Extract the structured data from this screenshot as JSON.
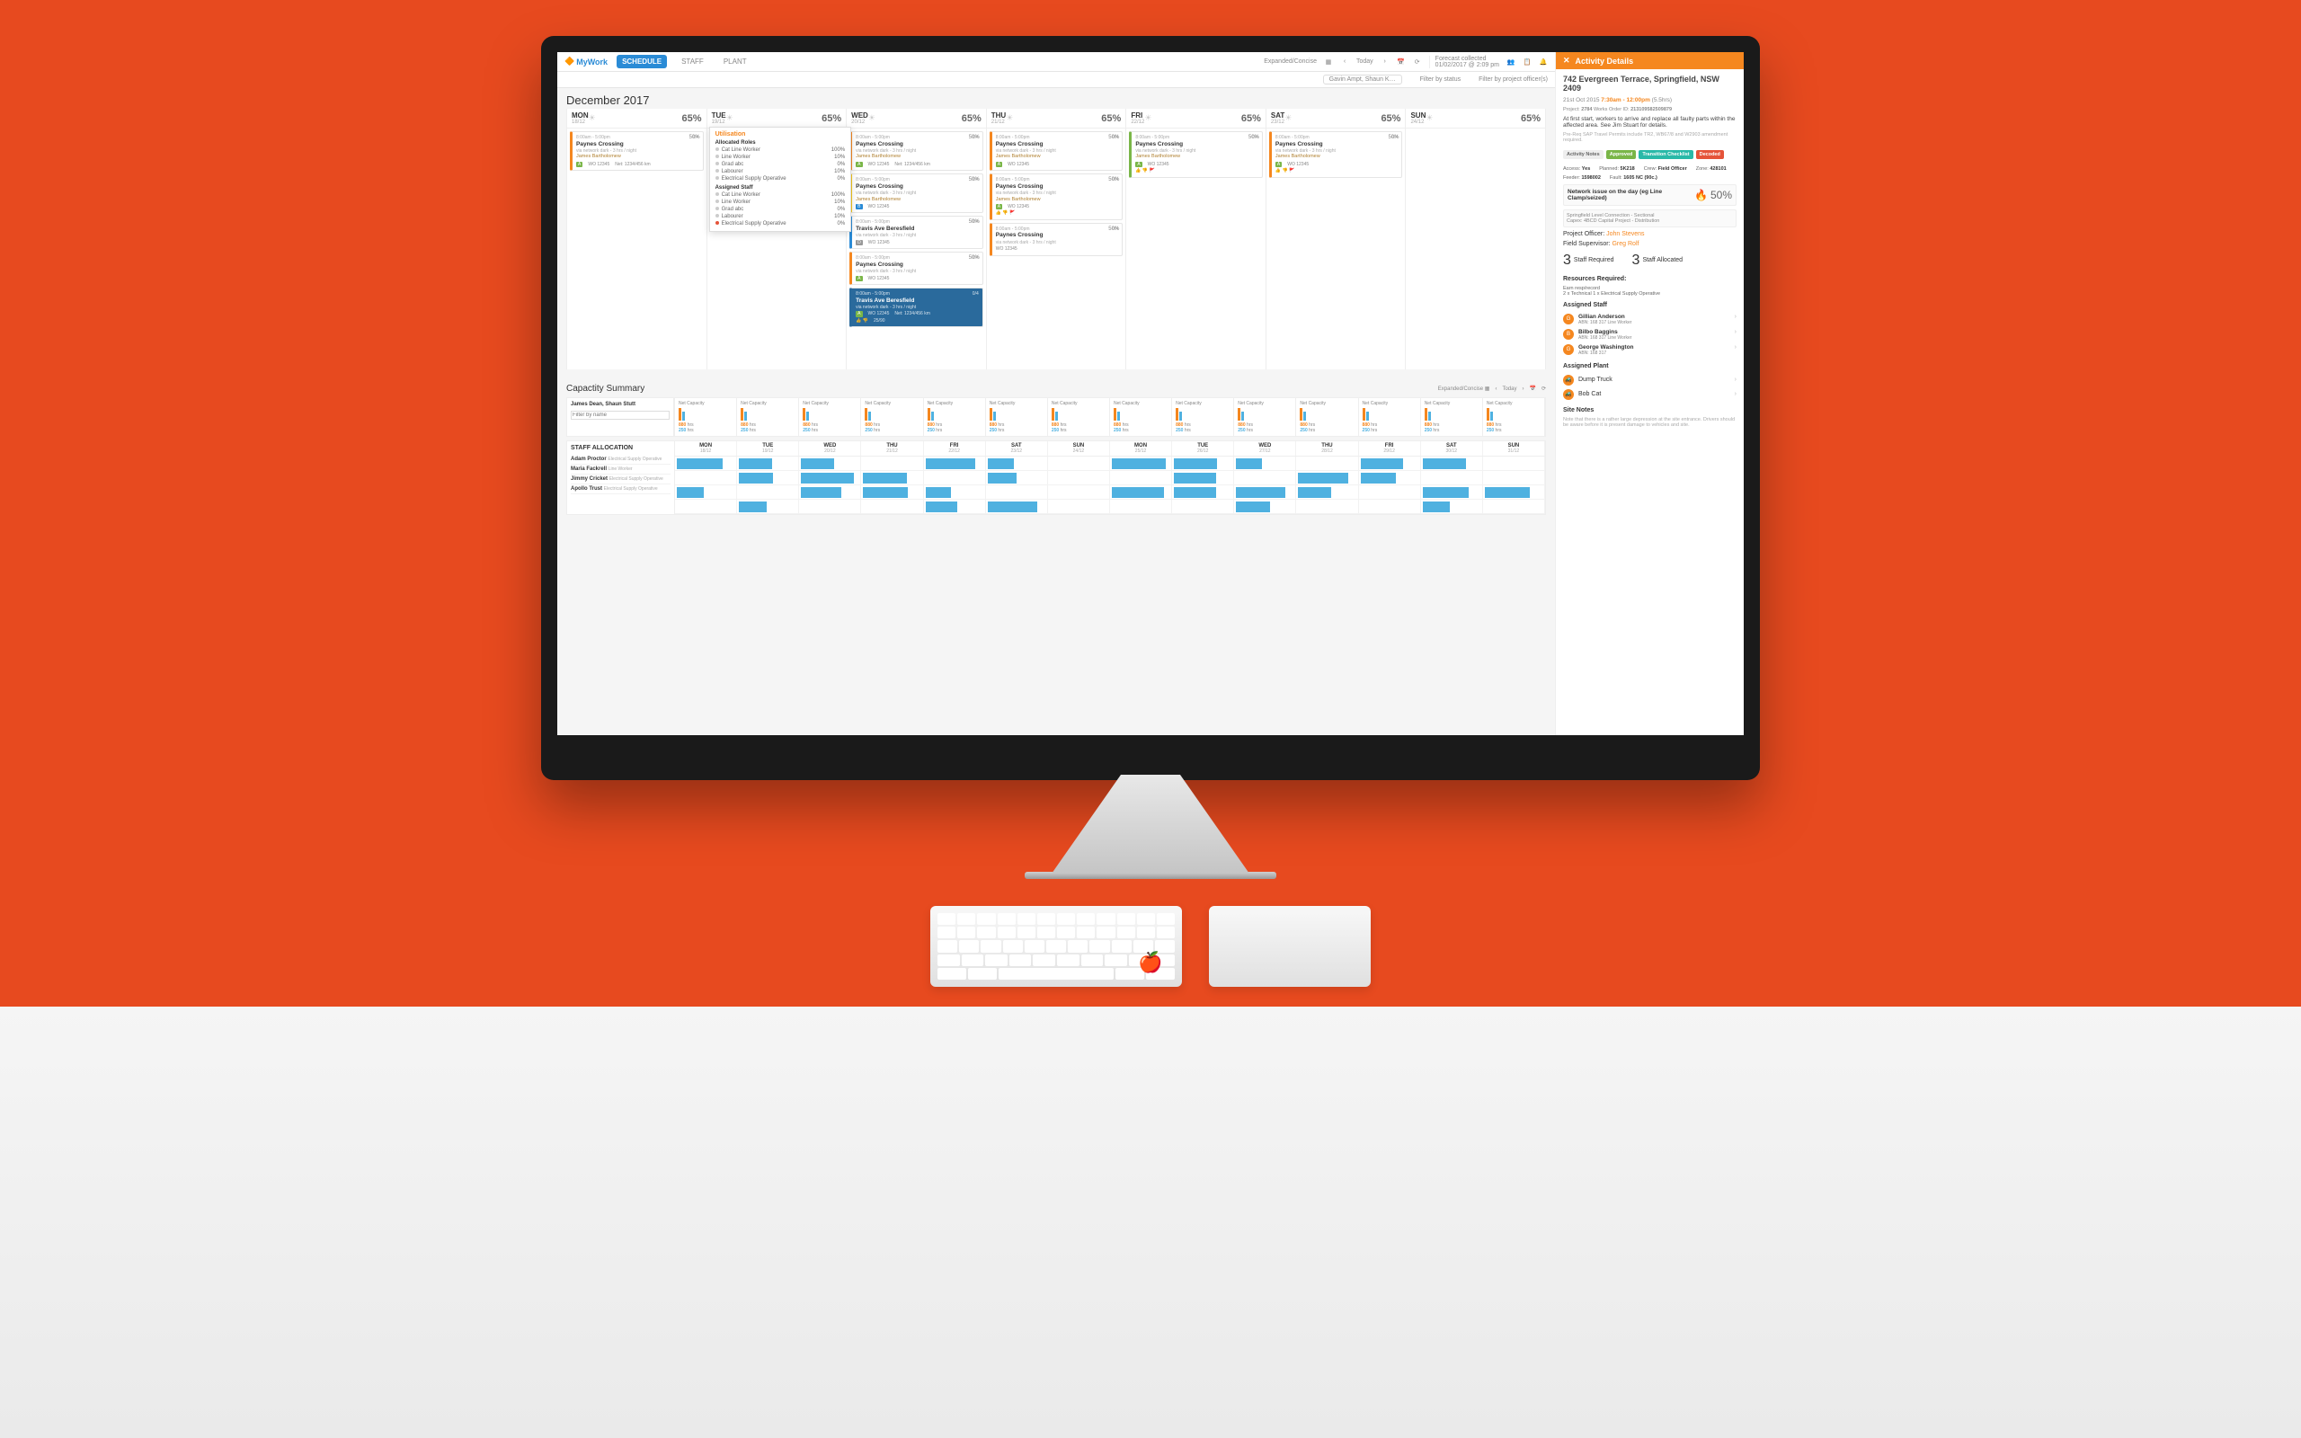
{
  "app": {
    "name": "MyWork"
  },
  "nav": {
    "tabs": [
      "SCHEDULE",
      "STAFF",
      "PLANT"
    ]
  },
  "top_right": {
    "view_toggle": "Expanded/Concise",
    "today": "Today",
    "forecast_label": "Forecast collected",
    "forecast_time": "01/02/2017 @ 2:09 pm"
  },
  "filters": {
    "people": "Gavin Ampt, Shaun K…",
    "status_ph": "Filter by status",
    "officer_ph": "Filter by project officer(s)"
  },
  "title": "December 2017",
  "days": [
    {
      "name": "MON",
      "date": "18/12",
      "util": "65%"
    },
    {
      "name": "TUE",
      "date": "19/12",
      "util": "65%"
    },
    {
      "name": "WED",
      "date": "20/12",
      "util": "65%"
    },
    {
      "name": "THU",
      "date": "21/12",
      "util": "65%"
    },
    {
      "name": "FRI",
      "date": "22/12",
      "util": "65%"
    },
    {
      "name": "SAT",
      "date": "23/12",
      "util": "65%"
    },
    {
      "name": "SUN",
      "date": "24/12",
      "util": "65%"
    }
  ],
  "popover": {
    "title": "Utilisation",
    "sections": [
      {
        "heading": "Allocated Roles",
        "rows": [
          {
            "label": "Cat Line Worker",
            "val": "100%"
          },
          {
            "label": "Line Worker",
            "val": "10%"
          },
          {
            "label": "Grad abc",
            "val": "0%"
          },
          {
            "label": "Labourer",
            "val": "10%"
          },
          {
            "label": "Electrical Supply Operative",
            "val": "0%"
          }
        ]
      },
      {
        "heading": "Assigned Staff",
        "rows": [
          {
            "label": "Cat Line Worker",
            "val": "100%"
          },
          {
            "label": "Line Worker",
            "val": "10%"
          },
          {
            "label": "Grad abc",
            "val": "0%"
          },
          {
            "label": "Labourer",
            "val": "10%"
          },
          {
            "label": "Electrical Supply Operative",
            "val": "0%"
          }
        ]
      }
    ]
  },
  "cards": {
    "time": "8:00am - 5:00pm",
    "count": "0/4",
    "title": "Paynes Crossing",
    "sub": "via network dark - 3 hrs / night",
    "name": "James Bartholomew",
    "wo": "WO 12345",
    "net": "Net: 1234/456 km",
    "pct": "50%",
    "sel_title": "Travis Ave Beresfield",
    "sel_meta": "25/90"
  },
  "capacity": {
    "title": "Capactity Summary",
    "names_label": "James Dean, Shaun Stutt",
    "cap_label": "Net Capacity",
    "cap_n": "880",
    "hrs": "hrs",
    "alloc_n": "250",
    "days": [
      {
        "d": "MON",
        "dd": "18/12"
      },
      {
        "d": "TUE",
        "dd": "19/12"
      },
      {
        "d": "WED",
        "dd": "20/12"
      },
      {
        "d": "THU",
        "dd": "21/12"
      },
      {
        "d": "FRI",
        "dd": "22/12"
      },
      {
        "d": "SAT",
        "dd": "23/12"
      },
      {
        "d": "SUN",
        "dd": "24/12"
      },
      {
        "d": "MON",
        "dd": "25/12"
      },
      {
        "d": "TUE",
        "dd": "26/12"
      },
      {
        "d": "WED",
        "dd": "27/12"
      },
      {
        "d": "THU",
        "dd": "28/12"
      },
      {
        "d": "FRI",
        "dd": "29/12"
      },
      {
        "d": "SAT",
        "dd": "30/12"
      },
      {
        "d": "SUN",
        "dd": "31/12"
      }
    ],
    "alloc_h": "STAFF ALLOCATION",
    "staff": [
      {
        "n": "Adam Proctor",
        "r": "Electrical Supply Operative"
      },
      {
        "n": "Maria Fackrell",
        "r": "Line Worker"
      },
      {
        "n": "Jimmy Cricket",
        "r": "Electrical Supply Operative"
      },
      {
        "n": "Apollo Trust",
        "r": "Electrical Supply Operative"
      }
    ]
  },
  "details": {
    "panel_title": "Activity Details",
    "address": "742 Evergreen Terrace, Springfield, NSW 2409",
    "date": "21st Oct 2015",
    "time": "7:30am - 12:00pm",
    "dur": "(5.5hrs)",
    "project": "2784 ",
    "wo_label": "Works Order ID:",
    "wo": "213109582509879",
    "description": "At first start, workers to arrive and replace all faulty parts within the affected area. See Jim Stuart for details.",
    "fine": "Pre-Req SAP Travel Permits include TR2, WB67/8 and W2903 amendment required.",
    "chips": [
      "Activity Notes",
      "Approved",
      "Transition Checklist",
      "Decoded"
    ],
    "info": {
      "access": "Yes",
      "startdate": "5K218",
      "crew": "Field Officer",
      "zone": "428101",
      "feeder": "1598002",
      "fault": "1605 NC (90c.)"
    },
    "warn": "Network issue on the day (eg Line Clamp/seized)",
    "warn_pct": "50%",
    "tags": [
      "Springfield Level Connection - Sectional",
      "Capex: 4BCD Capital Project - Distribution"
    ],
    "po_label": "Project Officer:",
    "po": "John Stevens",
    "fs_label": "Field Supervisor:",
    "fs": "Greg Rolf",
    "staff_req": "3",
    "staff_req_l": "Staff Required",
    "staff_asg": "3",
    "staff_asg_l": "Staff Allocated",
    "res_h": "Resources Required:",
    "res": [
      "Earn resp/record",
      "2 x Technical   1 x Electrical Supply Operative"
    ],
    "as_h": "Assigned Staff",
    "staff": [
      {
        "n": "Gillian Anderson",
        "r": "ABN: 168 317  Line Worker"
      },
      {
        "n": "Bilbo Baggins",
        "r": "ABN: 168 317  Line Worker"
      },
      {
        "n": "George Washington",
        "r": "ABN: 168 317"
      }
    ],
    "ap_h": "Assigned Plant",
    "plant": [
      "Dump Truck",
      "Bob Cat"
    ],
    "notes_h": "Site Notes",
    "notes": "Note that there is a rather large depression at the site entrance. Drivers should be aware before it is present damage to vehicles and site."
  }
}
